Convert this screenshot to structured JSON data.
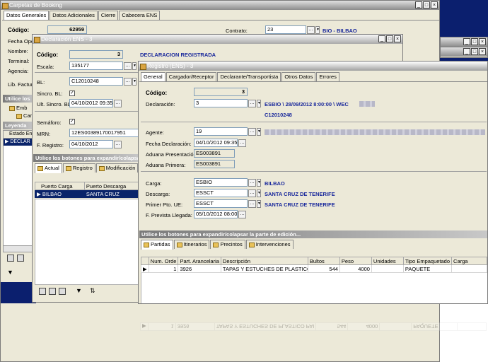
{
  "main_window": {
    "title": "Carpetas de Booking",
    "tabs": [
      "Datos Generales",
      "Datos Adicionales",
      "Cierre",
      "Cabecera ENS"
    ],
    "codigo_label": "Código:",
    "codigo_value": "62959",
    "fecha_label": "Fecha Ope",
    "nombre_label": "Nombre:",
    "terminal_label": "Terminal:",
    "agencia_label": "Agencia:",
    "lib_factura_label": "Lib. Factur",
    "contrato_label": "Contrato:",
    "contrato_value": "23",
    "contrato_desc": "BIO - BILBAO",
    "utilice_label": "Utilice los",
    "left_items": [
      "Emb",
      "Car"
    ],
    "leyenda_label": "Leyenda",
    "estado_header": "Estado En",
    "declara_row": "DECLAR"
  },
  "declaracion_window": {
    "title": "Declaración ENS - 3",
    "codigo_label": "Código:",
    "codigo_value": "3",
    "status": "DECLARACION REGISTRADA",
    "escala_label": "Escala:",
    "escala_value": "135177",
    "bl_label": "BL:",
    "bl_value": "C12010248",
    "sincro_label": "Sincro. BL:",
    "ult_sincro_label": "Ult. Sincro. BL:",
    "ult_sincro_value": "04/10/2012 09:35",
    "semaforo_label": "Semáforo:",
    "mrn_label": "MRN:",
    "mrn_value": "12ES00389170017951",
    "f_registro_label": "F. Registro:",
    "f_registro_value": "04/10/2012",
    "expand_header": "Utilice los botones para expandir/colapsar la parte de edición...",
    "subtabs": [
      "Actual",
      "Registro",
      "Modificación"
    ],
    "grid_headers": [
      "Puerto Carga",
      "Puerto Descarga"
    ],
    "grid_row": [
      "BILBAO",
      "SANTA CRUZ"
    ]
  },
  "registro_window": {
    "title": "Registro (ENS) - 3",
    "tabs": [
      "General",
      "Cargador/Receptor",
      "Declarante/Transportista",
      "Otros Datos",
      "Errores"
    ],
    "codigo_label": "Código:",
    "codigo_value": "3",
    "declaracion_label": "Declaración:",
    "declaracion_value": "3",
    "declaracion_desc": "ESBIO \\ 28/09/2012 8:00:00 \\ WEC",
    "declaracion_bl": "C12010248",
    "agente_label": "Agente:",
    "agente_value": "19",
    "fecha_decl_label": "Fecha Declaración:",
    "fecha_decl_value": "04/10/2012 09:35",
    "aduana_pres_label": "Aduana Presentación:",
    "aduana_pres_value": "ES003891",
    "aduana_prim_label": "Aduana Primera:",
    "aduana_prim_value": "ES003891",
    "carga_label": "Carga:",
    "carga_value": "ESBIO",
    "carga_desc": "BILBAO",
    "descarga_label": "Descarga:",
    "descarga_value": "ESSCT",
    "descarga_desc": "SANTA CRUZ DE TENERIFE",
    "primer_label": "Primer Pto. UE:",
    "primer_value": "ESSCT",
    "primer_desc": "SANTA CRUZ DE TENERIFE",
    "f_prevista_label": "F. Prevista Llegada:",
    "f_prevista_value": "05/10/2012 08:00",
    "expand_header": "Utilice los botones para expandir/colapsar la parte de edición...",
    "subtabs": [
      "Partidas",
      "Itinerarios",
      "Precintos",
      "Intervenciones"
    ],
    "grid_headers": [
      "Num. Orde",
      "Part. Arancelaria",
      "Descripción",
      "Bultos",
      "Peso",
      "Unidades",
      "Tipo Empaquetado",
      "Carga"
    ],
    "grid_row": [
      "1",
      "3926",
      "TAPAS Y ESTUCHES DE PLASTICO PAI",
      "544",
      "4000",
      "",
      "PAQUETE",
      ""
    ]
  },
  "colors": {
    "accent_text": "#1b2a9c",
    "title_gradient": "#8c8c8c",
    "desktop": "#0b1f6e"
  }
}
